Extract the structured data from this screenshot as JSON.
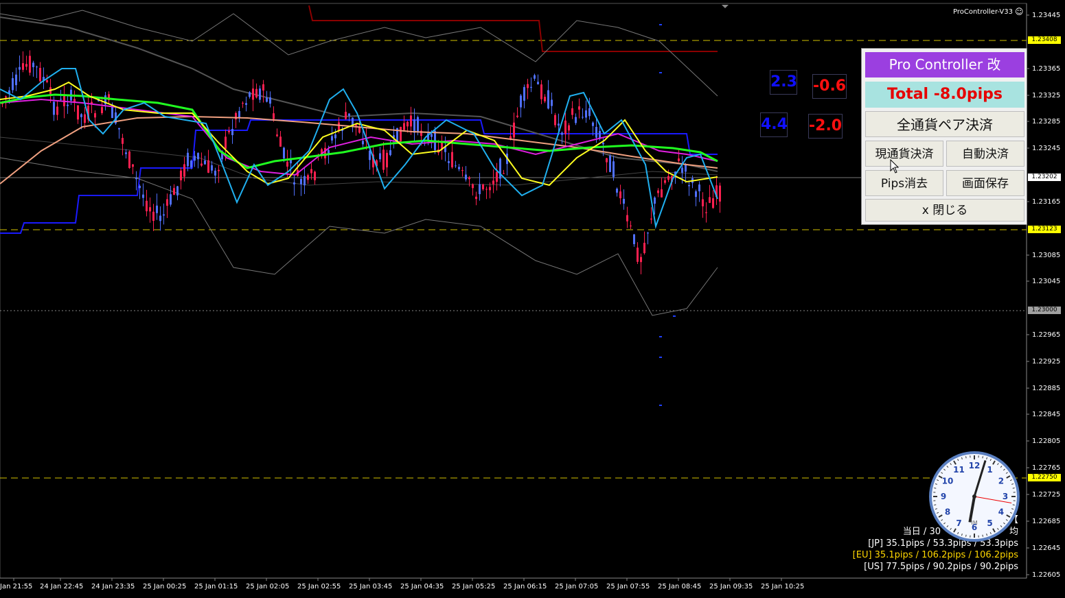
{
  "window": {
    "title": "ProController-V33"
  },
  "price_axis": {
    "ticks": [
      "1.23445",
      "1.23365",
      "1.23325",
      "1.23285",
      "1.23245",
      "1.23165",
      "1.23085",
      "1.23045",
      "1.22965",
      "1.22925",
      "1.22885",
      "1.22845",
      "1.22805",
      "1.22765",
      "1.22725",
      "1.22685",
      "1.22645",
      "1.22605"
    ],
    "tags": [
      {
        "label": "1.23408",
        "color": "#ffff00"
      },
      {
        "label": "1.23202",
        "color": "#ffffff"
      },
      {
        "label": "1.23123",
        "color": "#ffff00"
      },
      {
        "label": "1.23000",
        "color": "#a0a0a0"
      },
      {
        "label": "1.22750",
        "color": "#ffff00"
      }
    ]
  },
  "time_axis": {
    "labels": [
      "Jan 21:55",
      "24 Jan 22:45",
      "24 Jan 23:35",
      "25 Jan 00:25",
      "25 Jan 01:15",
      "25 Jan 02:05",
      "25 Jan 02:55",
      "25 Jan 03:45",
      "25 Jan 04:35",
      "25 Jan 05:25",
      "25 Jan 06:15",
      "25 Jan 07:05",
      "25 Jan 07:55",
      "25 Jan 08:45",
      "25 Jan 09:35",
      "25 Jan 10:25"
    ]
  },
  "pips_boxes": [
    {
      "value": "2.3",
      "color": "#1010ff"
    },
    {
      "value": "-0.6",
      "color": "#ff1010"
    },
    {
      "value": "4.4",
      "color": "#1010ff"
    },
    {
      "value": "-2.0",
      "color": "#ff1010"
    }
  ],
  "panel": {
    "header": "Pro Controller 改",
    "total": "Total   -8.0pips",
    "close_all": "全通貨ペア決済",
    "close_current": "現通貨決済",
    "auto_close": "自動決済",
    "pips_clear": "Pips消去",
    "screen_save": "画面保存",
    "close": "x 閉じる"
  },
  "stats": {
    "line1": "【",
    "line2": "当日 / 30",
    "line2_tail": "均",
    "jp": "[JP] 35.1pips / 53.3pips / 53.3pips",
    "eu": "[EU] 35.1pips / 106.2pips / 106.2pips",
    "us": "[US] 77.5pips / 90.2pips / 90.2pips",
    "eu_color": "#ffd700"
  },
  "clock": {
    "numbers": [
      "12",
      "1",
      "2",
      "3",
      "4",
      "5",
      "6",
      "7",
      "8",
      "9",
      "10",
      "11"
    ],
    "face_text": "IM",
    "hour_angle": 8,
    "minute_angle": 2,
    "second_angle": 100
  }
}
